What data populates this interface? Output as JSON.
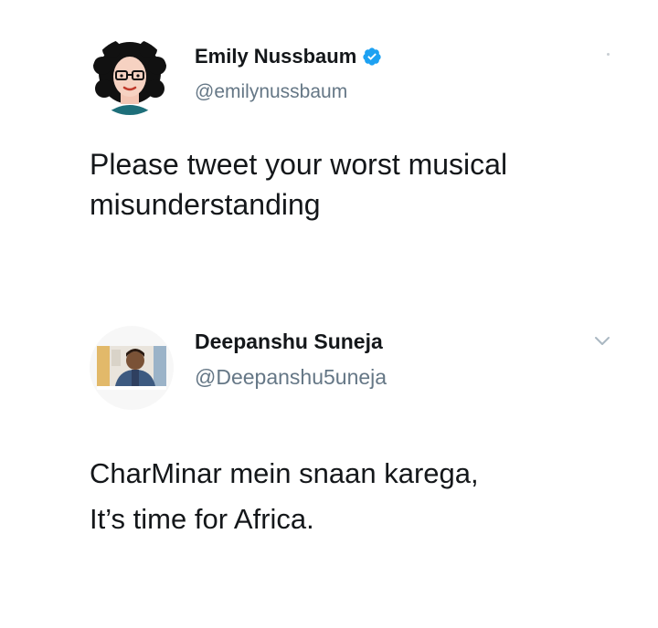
{
  "tweets": [
    {
      "author_name": "Emily Nussbaum",
      "handle": "@emilynussbaum",
      "verified": true,
      "lines": [
        "Please tweet your worst musical",
        "misunderstanding"
      ]
    },
    {
      "author_name": "Deepanshu Suneja",
      "handle": "@Deepanshu5uneja",
      "verified": false,
      "lines": [
        "CharMinar mein snaan karega,",
        "It’s time for Africa."
      ]
    }
  ],
  "icons": {
    "verified": "verified-badge-icon",
    "more": "chevron-down-icon"
  },
  "colors": {
    "verified_blue": "#1da1f2",
    "handle_gray": "#657786",
    "text": "#14171a"
  }
}
